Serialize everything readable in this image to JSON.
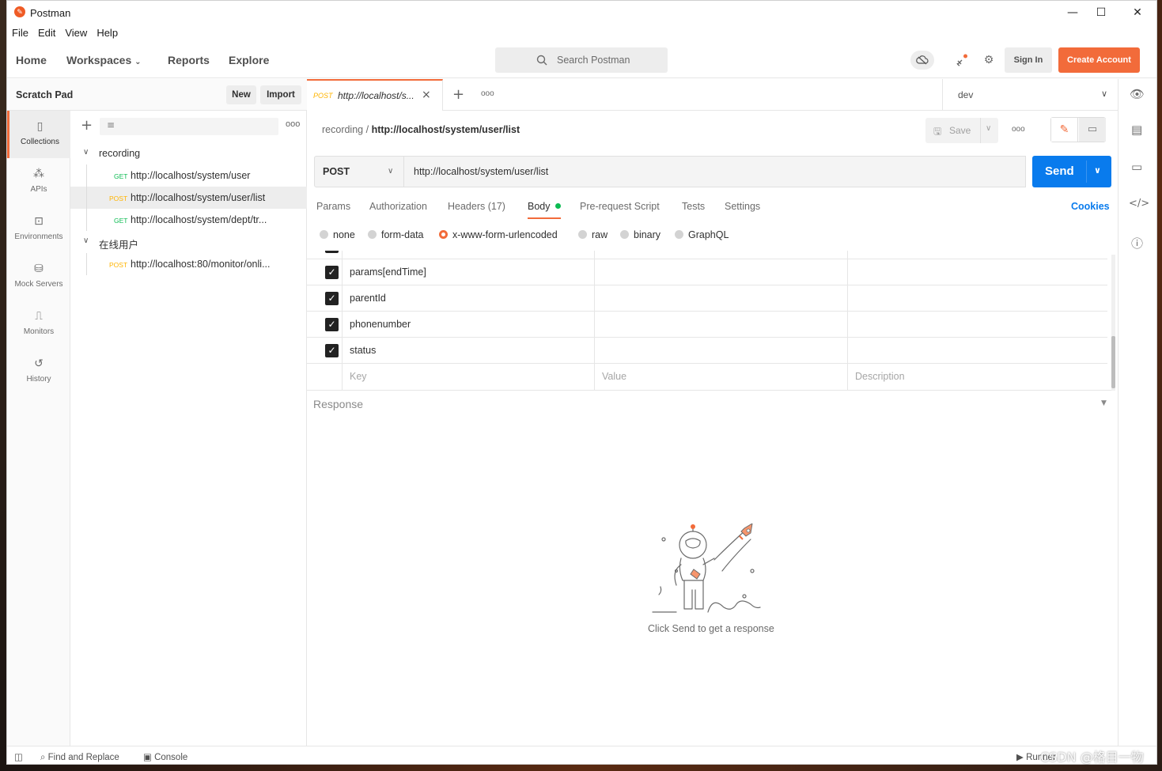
{
  "window": {
    "title": "Postman",
    "minimize": "—",
    "maximize": "☐",
    "close": "✕"
  },
  "menu": [
    "File",
    "Edit",
    "View",
    "Help"
  ],
  "header": {
    "nav": [
      "Home",
      "Workspaces",
      "Reports",
      "Explore"
    ],
    "search_placeholder": "Search Postman",
    "sign_in": "Sign In",
    "create_account": "Create Account"
  },
  "sidebar": {
    "title": "Scratch Pad",
    "new_label": "New",
    "import_label": "Import",
    "rail": [
      {
        "label": "Collections",
        "icon": "collections-icon",
        "active": true
      },
      {
        "label": "APIs",
        "icon": "apis-icon"
      },
      {
        "label": "Environments",
        "icon": "environments-icon"
      },
      {
        "label": "Mock Servers",
        "icon": "mock-servers-icon"
      },
      {
        "label": "Monitors",
        "icon": "monitors-icon"
      },
      {
        "label": "History",
        "icon": "history-icon"
      }
    ],
    "folders": [
      {
        "name": "recording",
        "requests": [
          {
            "method": "GET",
            "name": "http://localhost/system/user"
          },
          {
            "method": "POST",
            "name": "http://localhost/system/user/list",
            "active": true
          },
          {
            "method": "GET",
            "name": "http://localhost/system/dept/tr..."
          }
        ]
      },
      {
        "name": "在线用户",
        "requests": [
          {
            "method": "POST",
            "name": "http://localhost:80/monitor/onli..."
          }
        ]
      }
    ]
  },
  "tab": {
    "method": "POST",
    "title": "http://localhost/s..."
  },
  "environment": "dev",
  "breadcrumb": {
    "collection": "recording",
    "separator": "/",
    "request": "http://localhost/system/user/list"
  },
  "save_label": "Save",
  "request": {
    "method": "POST",
    "url": "http://localhost/system/user/list",
    "send_label": "Send"
  },
  "request_tabs": [
    "Params",
    "Authorization",
    "Headers (17)",
    "Body",
    "Pre-request Script",
    "Tests",
    "Settings"
  ],
  "active_request_tab": "Body",
  "cookies_label": "Cookies",
  "body_modes": [
    "none",
    "form-data",
    "x-www-form-urlencoded",
    "raw",
    "binary",
    "GraphQL"
  ],
  "selected_body_mode": "x-www-form-urlencoded",
  "form_rows": [
    {
      "key": "params[endTime]",
      "value": "",
      "description": "",
      "checked": true
    },
    {
      "key": "parentId",
      "value": "",
      "description": "",
      "checked": true
    },
    {
      "key": "phonenumber",
      "value": "",
      "description": "",
      "checked": true
    },
    {
      "key": "status",
      "value": "",
      "description": "",
      "checked": true
    }
  ],
  "form_placeholder": {
    "key": "Key",
    "value": "Value",
    "description": "Description"
  },
  "response": {
    "title": "Response",
    "empty_message": "Click Send to get a response"
  },
  "footer": {
    "find_replace": "Find and Replace",
    "console": "Console",
    "runner": "Runner"
  },
  "watermark": "CSDN @格目一物",
  "colors": {
    "accent": "#f26b3a",
    "send": "#097bed",
    "get": "#0cbb52",
    "post": "#ffb400"
  }
}
